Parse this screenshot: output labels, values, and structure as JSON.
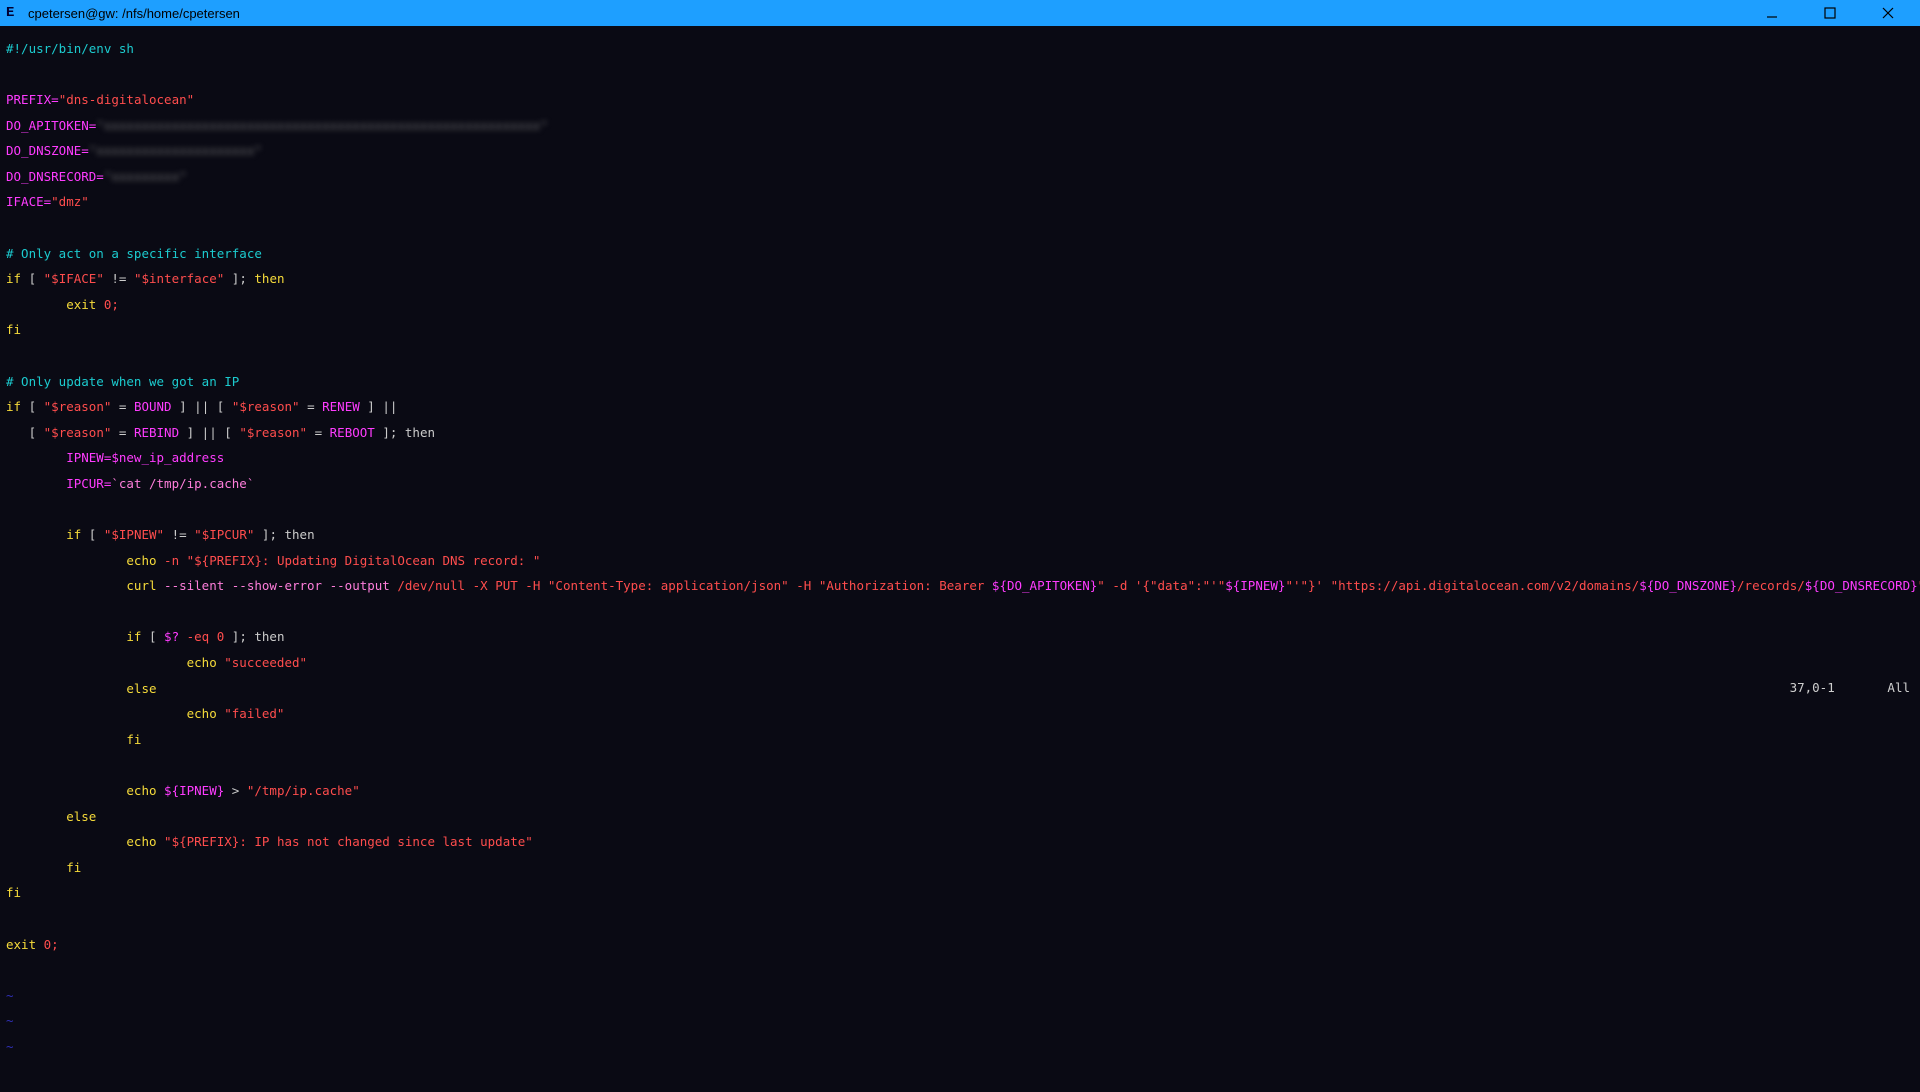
{
  "window": {
    "title": "cpetersen@gw: /nfs/home/cpetersen"
  },
  "status": {
    "pos": "37,0-1",
    "mode": "All"
  },
  "code": {
    "shebang": "#!/usr/bin/env sh",
    "prefix_key": "PREFIX=",
    "prefix_val": "\"dns-digitalocean\"",
    "do_apitoken_key": "DO_APITOKEN=",
    "do_apitoken_blur": "\"xxxxxxxxxxxxxxxxxxxxxxxxxxxxxxxxxxxxxxxxxxxxxxxxxxxxxxxxxx\"",
    "do_dnszone_key": "DO_DNSZONE=",
    "do_dnszone_blur": "\"xxxxxxxxxxxxxxxxxxxxx\"",
    "do_dnsrecord_key": "DO_DNSRECORD=",
    "do_dnsrecord_blur": "\"xxxxxxxxx\"",
    "iface_key": "IFACE=",
    "iface_val": "\"dmz\"",
    "cm_only_iface": "# Only act on a specific interface",
    "if1_a": "if",
    "if1_b": " [ ",
    "if1_c": "\"$IFACE\"",
    "if1_d": " != ",
    "if1_e": "\"$interface\"",
    "if1_f": " ]; ",
    "if1_g": "then",
    "exit0_1": "        exit",
    "exit0_1b": " 0;",
    "fi": "fi",
    "cm_only_update": "# Only update when we got an IP",
    "if2_a": "if",
    "if2_b": " [ ",
    "reason": "\"$reason\"",
    "eq": " = ",
    "bound": "BOUND",
    "br": " ] || [ ",
    "renew": "RENEW",
    "end_or": " ] ||",
    "ind": "   [ ",
    "rebind": "REBIND",
    "reboot": "REBOOT",
    "then_end": " ]; then",
    "ipnew_a": "        IPNEW=",
    "ipnew_b": "$new_ip_address",
    "ipcur_a": "        IPCUR=",
    "ipcur_tick": "`",
    "cat": "cat /tmp/ip.cache",
    "if3_a": "        if",
    "if3_b": " [ ",
    "ipnew_v": "\"$IPNEW\"",
    "neq": " != ",
    "ipcur_v": "\"$IPCUR\"",
    "then_end2": " ]; then",
    "echo_pre": "                echo",
    "dash_n": " -n ",
    "updating_a": "\"${PREFIX}",
    "updating_b": ": Updating DigitalOcean DNS record: \"",
    "curl_ind": "                curl ",
    "curl_flags": "--silent --show-error --output",
    "devnull": " /dev/null ",
    "put": "-X PUT -H ",
    "ct": "\"Content-Type: application/json\"",
    "h2": " -H ",
    "auth_a": "\"Authorization: Bearer ",
    "auth_b": "${DO_APITOKEN}",
    "auth_c": "\"",
    "d": " -d ",
    "data_a": "'{\"data\":\"'\"",
    "data_b": "${IPNEW}",
    "data_c": "\"'\"}'",
    "sp": " ",
    "url_a": "\"https://api.digitalocean.com/v2/domains/",
    "url_b": "${DO_DNSZONE}",
    "url_c": "/records/",
    "url_d": "${DO_DNSRECORD}",
    "url_e": "\"",
    "if4_a": "                if",
    "if4_b": " [ ",
    "q": "$?",
    "eq0": " -eq 0",
    "then_end3": " ]; then",
    "echo_succ_a": "                        echo ",
    "succ": "\"succeeded\"",
    "else16": "                else",
    "echo_fail_a": "                        echo ",
    "fail": "\"failed\"",
    "fi16": "                fi",
    "echo_cache_a": "                echo ",
    "ipnew_var": "${IPNEW}",
    "gt": " > ",
    "cache_path": "\"/tmp/ip.cache\"",
    "else8": "        else",
    "echo_same_a": "                echo ",
    "same_a": "\"${PREFIX}",
    "same_b": ": IP has not changed since last update\"",
    "fi8": "        fi",
    "fi0": "fi",
    "exit_last": "exit",
    "exit_last_b": " 0;",
    "tilde": "~"
  }
}
